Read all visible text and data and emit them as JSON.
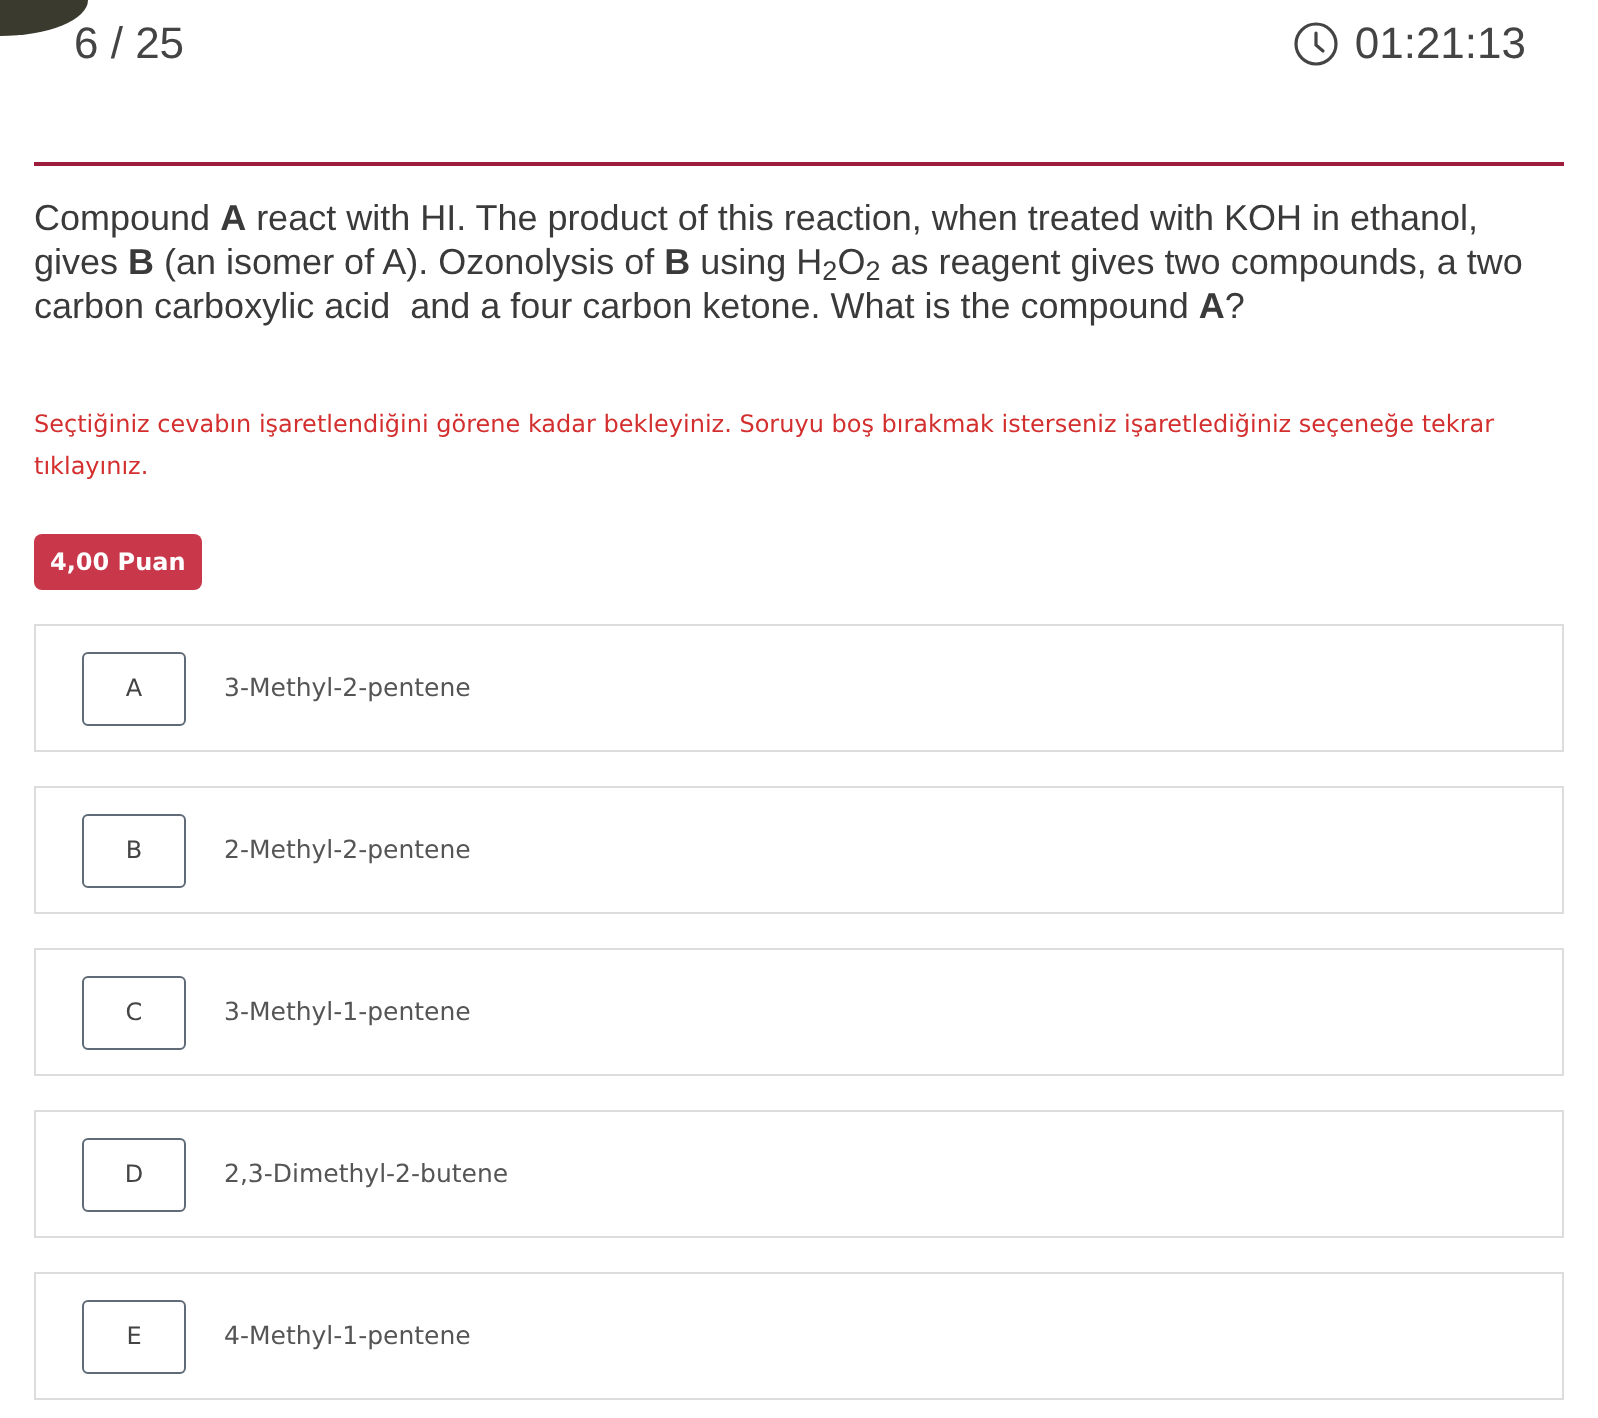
{
  "header": {
    "progress": "6 / 25",
    "timer": "01:21:13"
  },
  "question": {
    "text": "Compound **A** react with HI. The product of this reaction, when treated with KOH in ethanol, gives **B** (an isomer of A). Ozonolysis of **B** using H$_{2}$O$_{2}$ as reagent gives two compounds, a two carbon carboxylic acid  and a four carbon ketone. What is the compound **A**?",
    "notice": "Seçtiğiniz cevabın işaretlendiğini görene kadar bekleyiniz. Soruyu boş bırakmak isterseniz işaretlediğiniz seçeneğe tekrar tıklayınız.",
    "points": "4,00 Puan"
  },
  "options": [
    {
      "letter": "A",
      "text": "3-Methyl-2-pentene",
      "selected": false
    },
    {
      "letter": "B",
      "text": "2-Methyl-2-pentene",
      "selected": false
    },
    {
      "letter": "C",
      "text": "3-Methyl-1-pentene",
      "selected": false
    },
    {
      "letter": "D",
      "text": "2,3-Dimethyl-2-butene",
      "selected": false
    },
    {
      "letter": "E",
      "text": "4-Methyl-1-pentene",
      "selected": false
    }
  ]
}
